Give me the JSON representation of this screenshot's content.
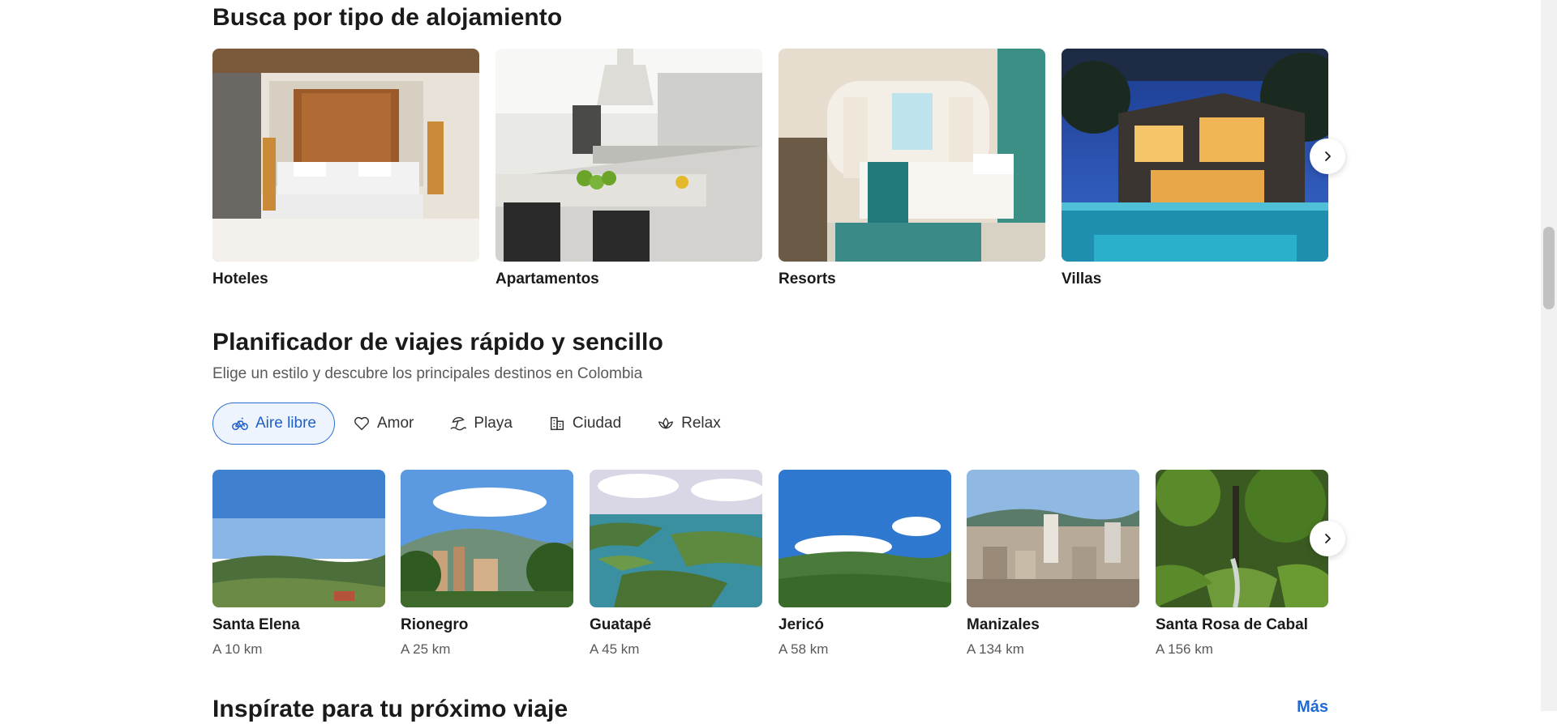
{
  "accommodation": {
    "title": "Busca por tipo de alojamiento",
    "types": [
      {
        "label": "Hoteles"
      },
      {
        "label": "Apartamentos"
      },
      {
        "label": "Resorts"
      },
      {
        "label": "Villas"
      }
    ]
  },
  "planner": {
    "title": "Planificador de viajes rápido y sencillo",
    "subtitle": "Elige un estilo y descubre los principales destinos en Colombia",
    "styles": [
      {
        "label": "Aire libre",
        "icon": "bicycle-icon",
        "active": true
      },
      {
        "label": "Amor",
        "icon": "heart-icon",
        "active": false
      },
      {
        "label": "Playa",
        "icon": "beach-icon",
        "active": false
      },
      {
        "label": "Ciudad",
        "icon": "city-icon",
        "active": false
      },
      {
        "label": "Relax",
        "icon": "lotus-icon",
        "active": false
      }
    ],
    "destinations": [
      {
        "name": "Santa Elena",
        "distance": "A 10 km"
      },
      {
        "name": "Rionegro",
        "distance": "A 25 km"
      },
      {
        "name": "Guatapé",
        "distance": "A 45 km"
      },
      {
        "name": "Jericó",
        "distance": "A 58 km"
      },
      {
        "name": "Manizales",
        "distance": "A 134 km"
      },
      {
        "name": "Santa Rosa de Cabal",
        "distance": "A 156 km"
      }
    ]
  },
  "inspiration": {
    "title": "Inspírate para tu próximo viaje",
    "more_label": "Más"
  },
  "colors": {
    "accent": "#2f6fd4",
    "text": "#1a1a1a",
    "muted": "#595959"
  }
}
